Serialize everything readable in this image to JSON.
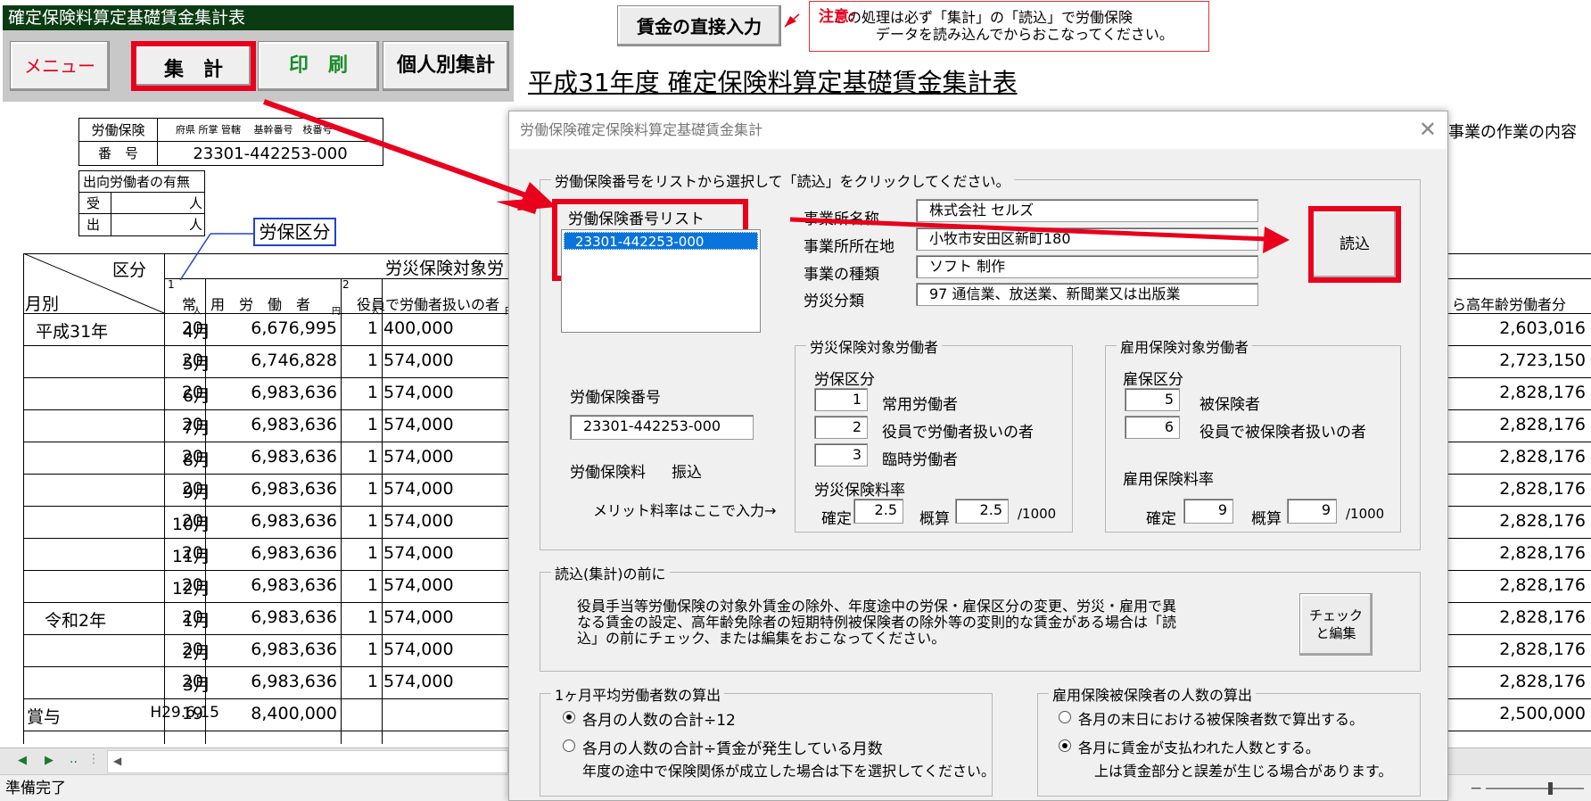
{
  "menu": {
    "title": "確定保険料算定基礎賃金集計表",
    "menu_btn": "メニュー",
    "total_btn": "集　計",
    "print_btn": "印　刷",
    "individual_btn": "個人別集計"
  },
  "direct_btn": "賃金の直接入力",
  "note": {
    "label": "注意:",
    "text1": "この処理は必ず「集計」の「読込」で労働保険",
    "text2": "データを読み込んでからおこなってください。"
  },
  "sheet_title": "平成31年度 確定保険料算定基礎賃金集計表",
  "ins_box": {
    "label1": "労働保険",
    "header": "府県 所掌 管轄　 基幹番号　枝番号",
    "label2": "番　号",
    "number": "23301-442253-000"
  },
  "dispatch": {
    "title": "出向労働者の有無",
    "row1": "受",
    "row2": "出",
    "unit": "人"
  },
  "kubun_label": "労保区分",
  "table": {
    "head_kubun": "区分",
    "head_month": "月別",
    "head_rousai": "労災保険対象労",
    "col1_num": "1",
    "col1_label": "常　用　労　働　者",
    "col2_num": "2",
    "col2_label": "役員で労働者扱いの者",
    "unit_person": "人",
    "unit_yen": "円",
    "right_head": "ら高年齢労働者分",
    "right_top": "事業の作業の内容",
    "rows": [
      {
        "era": "平成31年",
        "month": "4月",
        "c1": "20",
        "w1": "6,676,995",
        "c2": "1",
        "w2": "400,000",
        "r": "2,603,016"
      },
      {
        "era": "",
        "month": "5月",
        "c1": "20",
        "w1": "6,746,828",
        "c2": "1",
        "w2": "574,000",
        "r": "2,723,150"
      },
      {
        "era": "",
        "month": "6月",
        "c1": "20",
        "w1": "6,983,636",
        "c2": "1",
        "w2": "574,000",
        "r": "2,828,176"
      },
      {
        "era": "",
        "month": "7月",
        "c1": "20",
        "w1": "6,983,636",
        "c2": "1",
        "w2": "574,000",
        "r": "2,828,176"
      },
      {
        "era": "",
        "month": "8月",
        "c1": "20",
        "w1": "6,983,636",
        "c2": "1",
        "w2": "574,000",
        "r": "2,828,176"
      },
      {
        "era": "",
        "month": "9月",
        "c1": "20",
        "w1": "6,983,636",
        "c2": "1",
        "w2": "574,000",
        "r": "2,828,176"
      },
      {
        "era": "",
        "month": "10月",
        "c1": "20",
        "w1": "6,983,636",
        "c2": "1",
        "w2": "574,000",
        "r": "2,828,176"
      },
      {
        "era": "",
        "month": "11月",
        "c1": "20",
        "w1": "6,983,636",
        "c2": "1",
        "w2": "574,000",
        "r": "2,828,176"
      },
      {
        "era": "",
        "month": "12月",
        "c1": "20",
        "w1": "6,983,636",
        "c2": "1",
        "w2": "574,000",
        "r": "2,828,176"
      },
      {
        "era": "令和2年",
        "month": "1月",
        "c1": "20",
        "w1": "6,983,636",
        "c2": "1",
        "w2": "574,000",
        "r": "2,828,176"
      },
      {
        "era": "",
        "month": "2月",
        "c1": "20",
        "w1": "6,983,636",
        "c2": "1",
        "w2": "574,000",
        "r": "2,828,176"
      },
      {
        "era": "",
        "month": "3月",
        "c1": "20",
        "w1": "6,983,636",
        "c2": "1",
        "w2": "574,000",
        "r": "2,828,176"
      },
      {
        "era": "賞与",
        "month": "H29.6.15",
        "c1": "19",
        "w1": "8,400,000",
        "c2": "",
        "w2": "",
        "r": "2,500,000"
      }
    ]
  },
  "status": "準備完了",
  "dialog": {
    "title": "労働保険確定保険料算定基礎賃金集計",
    "group_select": "労働保険番号をリストから選択して「読込」をクリックしてください。",
    "list_label": "労働保険番号リスト",
    "list_item": "23301-442253-000",
    "office_name_label": "事業所名称",
    "office_name": "株式会社 セルズ",
    "office_addr_label": "事業所所在地",
    "office_addr": "小牧市安田区新町180",
    "business_type_label": "事業の種類",
    "business_type": "ソフト 制作",
    "rousai_class_label": "労災分類",
    "rousai_class": "97 通信業、放送業、新聞業又は出版業",
    "read_btn": "読込",
    "ins_num_label": "労働保険番号",
    "ins_num": "23301-442253-000",
    "premium_label": "労働保険料",
    "premium_value": "振込",
    "merit_label": "メリット料率はここで入力→",
    "rousai_group": "労災保険対象労働者",
    "rousai_kubun": "労保区分",
    "rousai_items": [
      {
        "val": "1",
        "label": "常用労働者"
      },
      {
        "val": "2",
        "label": "役員で労働者扱いの者"
      },
      {
        "val": "3",
        "label": "臨時労働者"
      }
    ],
    "rousai_rate_label": "労災保険料率",
    "confirmed": "確定",
    "rousai_confirmed": "2.5",
    "estimate": "概算",
    "rousai_estimate": "2.5",
    "per_mille": "/1000",
    "koyou_group": "雇用保険対象労働者",
    "koyou_kubun": "雇保区分",
    "koyou_items": [
      {
        "val": "5",
        "label": "被保険者"
      },
      {
        "val": "6",
        "label": "役員で被保険者扱いの者"
      }
    ],
    "koyou_rate_label": "雇用保険料率",
    "koyou_confirmed": "9",
    "koyou_estimate": "9",
    "before_group": "読込(集計)の前に",
    "before_text1": "役員手当等労働保険の対象外賃金の除外、年度途中の労保・雇保区分の変更、労災・雇用で異",
    "before_text2": "なる賃金の設定、高年齢免除者の短期特例被保険者の除外等の変則的な賃金がある場合は「読",
    "before_text3": "込」の前にチェック、または編集をおこなってください。",
    "check_btn1": "チェック",
    "check_btn2": "と編集",
    "avg_group": "1ヶ月平均労働者数の算出",
    "avg_opt1": "各月の人数の合計÷12",
    "avg_opt2": "各月の人数の合計÷賃金が発生している月数",
    "avg_note": "年度の途中で保険関係が成立した場合は下を選択してください。",
    "koyou_count_group": "雇用保険被保険者の人数の算出",
    "kc_opt1": "各月の末日における被保険者数で算出する。",
    "kc_opt2": "各月に賃金が支払われた人数とする。",
    "kc_note": "上は賃金部分と誤差が生じる場合があります。"
  }
}
